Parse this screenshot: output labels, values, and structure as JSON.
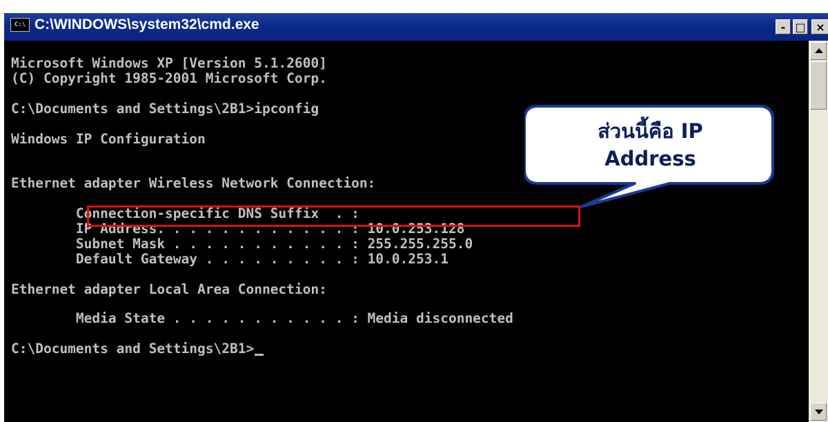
{
  "window": {
    "title": "C:\\WINDOWS\\system32\\cmd.exe",
    "icon_name": "console-app-icon",
    "icon_text": "C:\\",
    "buttons": {
      "minimize": "-",
      "maximize": "□",
      "close": "×"
    }
  },
  "console": {
    "lines": [
      "Microsoft Windows XP [Version 5.1.2600]",
      "(C) Copyright 1985-2001 Microsoft Corp.",
      "C:\\Documents and Settings\\2B1>ipconfig",
      "Windows IP Configuration",
      "Ethernet adapter Wireless Network Connection:",
      "        Connection-specific DNS Suffix  . :",
      "        IP Address. . . . . . . . . . . . : 10.0.253.128",
      "        Subnet Mask . . . . . . . . . . . : 255.255.255.0",
      "        Default Gateway . . . . . . . . . : 10.0.253.1",
      "Ethernet adapter Local Area Connection:",
      "        Media State . . . . . . . . . . . : Media disconnected",
      "C:\\Documents and Settings\\2B1>"
    ]
  },
  "annotation": {
    "callout_line1": "ส่วนนี้คือ IP",
    "callout_line2": "Address",
    "highlight_color": "#e01010",
    "callout_border_color": "#1a3a9c"
  },
  "colors": {
    "console_bg": "#000000",
    "console_fg": "#c0c0c0",
    "titlebar": "#0c2a8a"
  }
}
